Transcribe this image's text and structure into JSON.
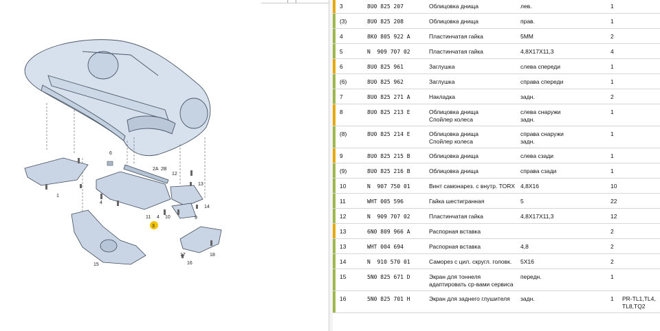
{
  "diagram": {
    "labels": [
      "6",
      "1",
      "4",
      "2A",
      "2B",
      "12",
      "13",
      "14",
      "10",
      "9",
      "11",
      "4",
      "3",
      "15",
      "17",
      "16",
      "18"
    ],
    "highlight": "3",
    "accent_color": "#f2c300",
    "part_color": "#c9d5e4"
  },
  "table": {
    "bar_colors": {
      "yellow": "#e3a90f",
      "green": "#9fb64a"
    },
    "rows": [
      {
        "pos": "3",
        "pn": "8U0 825 207",
        "desc": "Облицовка днища",
        "desc2": "",
        "note": "лев.",
        "note2": "",
        "qty": "1",
        "extra": "",
        "extra2": "",
        "bar": "#e3a90f"
      },
      {
        "pos": "(3)",
        "pn": "8U0 825 208",
        "desc": "Облицовка днища",
        "desc2": "",
        "note": "прав.",
        "note2": "",
        "qty": "1",
        "extra": "",
        "extra2": "",
        "bar": "#9fb64a"
      },
      {
        "pos": "4",
        "pn": "8K0 805 922 A",
        "desc": "Пластинчатая гайка",
        "desc2": "",
        "note": "5MM",
        "note2": "",
        "qty": "2",
        "extra": "",
        "extra2": "",
        "bar": "#9fb64a"
      },
      {
        "pos": "5",
        "pn": "N  909 707 02",
        "desc": "Пластинчатая гайка",
        "desc2": "",
        "note": "4,8X17X11,3",
        "note2": "",
        "qty": "4",
        "extra": "",
        "extra2": "",
        "bar": "#9fb64a"
      },
      {
        "pos": "6",
        "pn": "8U0 825 961",
        "desc": "Заглушка",
        "desc2": "",
        "note": "слева спереди",
        "note2": "",
        "qty": "1",
        "extra": "",
        "extra2": "",
        "bar": "#e3a90f"
      },
      {
        "pos": "(6)",
        "pn": "8U0 825 962",
        "desc": "Заглушка",
        "desc2": "",
        "note": "справа спереди",
        "note2": "",
        "qty": "1",
        "extra": "",
        "extra2": "",
        "bar": "#9fb64a"
      },
      {
        "pos": "7",
        "pn": "8U0 825 271 A",
        "desc": "Накладка",
        "desc2": "",
        "note": "задн.",
        "note2": "",
        "qty": "2",
        "extra": "",
        "extra2": "",
        "bar": "#9fb64a"
      },
      {
        "pos": "8",
        "pn": "8U0 825 213 E",
        "desc": "Облицовка днища",
        "desc2": "Спойлер колеса",
        "note": "слева снаружи",
        "note2": "задн.",
        "qty": "1",
        "extra": "",
        "extra2": "",
        "bar": "#e3a90f"
      },
      {
        "pos": "(8)",
        "pn": "8U0 825 214 E",
        "desc": "Облицовка днища",
        "desc2": "Спойлер колеса",
        "note": "справа снаружи",
        "note2": "задн.",
        "qty": "1",
        "extra": "",
        "extra2": "",
        "bar": "#9fb64a"
      },
      {
        "pos": "9",
        "pn": "8U0 825 215 B",
        "desc": "Облицовка днища",
        "desc2": "",
        "note": "слева сзади",
        "note2": "",
        "qty": "1",
        "extra": "",
        "extra2": "",
        "bar": "#e3a90f"
      },
      {
        "pos": "(9)",
        "pn": "8U0 825 216 B",
        "desc": "Облицовка днища",
        "desc2": "",
        "note": "справа сзади",
        "note2": "",
        "qty": "1",
        "extra": "",
        "extra2": "",
        "bar": "#9fb64a"
      },
      {
        "pos": "10",
        "pn": "N  907 750 01",
        "desc": "Винт самонарез. с внутр. TORX",
        "desc2": "",
        "note": "4,8X16",
        "note2": "",
        "qty": "10",
        "extra": "",
        "extra2": "",
        "bar": "#9fb64a"
      },
      {
        "pos": "11",
        "pn": "WHT 005 596",
        "desc": "Гайка шестигранная",
        "desc2": "",
        "note": "5",
        "note2": "",
        "qty": "22",
        "extra": "",
        "extra2": "",
        "bar": "#9fb64a"
      },
      {
        "pos": "12",
        "pn": "N  909 707 02",
        "desc": "Пластинчатая гайка",
        "desc2": "",
        "note": "4,8X17X11,3",
        "note2": "",
        "qty": "12",
        "extra": "",
        "extra2": "",
        "bar": "#9fb64a"
      },
      {
        "pos": "13",
        "pn": "6N0 809 966 A",
        "desc": "Распорная вставка",
        "desc2": "",
        "note": "",
        "note2": "",
        "qty": "2",
        "extra": "",
        "extra2": "",
        "bar": "#e3a90f"
      },
      {
        "pos": "13",
        "pn": "WHT 004 694",
        "desc": "Распорная вставка",
        "desc2": "",
        "note": "4,8",
        "note2": "",
        "qty": "2",
        "extra": "",
        "extra2": "",
        "bar": "#9fb64a"
      },
      {
        "pos": "14",
        "pn": "N  910 570 01",
        "desc": "Саморез с цил. скругл. головк.",
        "desc2": "",
        "note": "5X16",
        "note2": "",
        "qty": "2",
        "extra": "",
        "extra2": "",
        "bar": "#9fb64a"
      },
      {
        "pos": "15",
        "pn": "5N0 825 671 D",
        "desc": "Экран для тоннеля",
        "desc2": "адаптировать ср-вами сервиса",
        "note": "передн.",
        "note2": "",
        "qty": "1",
        "extra": "",
        "extra2": "",
        "bar": "#9fb64a"
      },
      {
        "pos": "16",
        "pn": "5N0 825 701 H",
        "desc": "Экран для заднего глушителя",
        "desc2": "",
        "note": "задн.",
        "note2": "",
        "qty": "1",
        "extra": "PR-TL1,TL4,",
        "extra2": "TL8,TQ2",
        "bar": "#9fb64a"
      }
    ]
  }
}
